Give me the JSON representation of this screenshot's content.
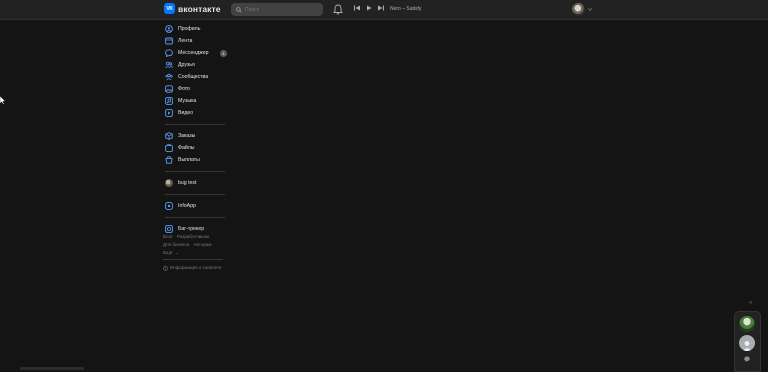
{
  "brand": {
    "logo_mark": "VK",
    "name": "вконтакте"
  },
  "search": {
    "placeholder": "Поиск"
  },
  "player": {
    "track": "Nero – Satisfy"
  },
  "sidebar": {
    "main": [
      {
        "label": "Профиль",
        "icon": "user-circle-icon"
      },
      {
        "label": "Лента",
        "icon": "newsfeed-icon"
      },
      {
        "label": "Мессенджер",
        "icon": "message-icon",
        "badge": "1"
      },
      {
        "label": "Друзья",
        "icon": "friends-icon"
      },
      {
        "label": "Сообщества",
        "icon": "communities-icon"
      },
      {
        "label": "Фото",
        "icon": "photo-icon"
      },
      {
        "label": "Музыка",
        "icon": "music-icon"
      },
      {
        "label": "Видео",
        "icon": "video-icon"
      }
    ],
    "secondary": [
      {
        "label": "Заказы",
        "icon": "box-icon"
      },
      {
        "label": "Файлы",
        "icon": "files-icon"
      },
      {
        "label": "Выплаты",
        "icon": "wallet-icon"
      }
    ],
    "apps": [
      {
        "label": "bug test",
        "icon": "app-avatar-icon"
      }
    ],
    "infoapp": {
      "label": "InfoApp",
      "icon": "app-icon"
    },
    "bugtracker": {
      "label": "Баг-трекер",
      "icon": "bug-icon"
    }
  },
  "footer": {
    "links_row1": [
      "Блог",
      "Разработчикам"
    ],
    "links_row2": [
      "Для бизнеса",
      "Авторам"
    ],
    "more": "Ещё",
    "info": "Информация о сниппете"
  },
  "colors": {
    "accent": "#0077ff",
    "background": "#141414",
    "header": "#222222"
  }
}
